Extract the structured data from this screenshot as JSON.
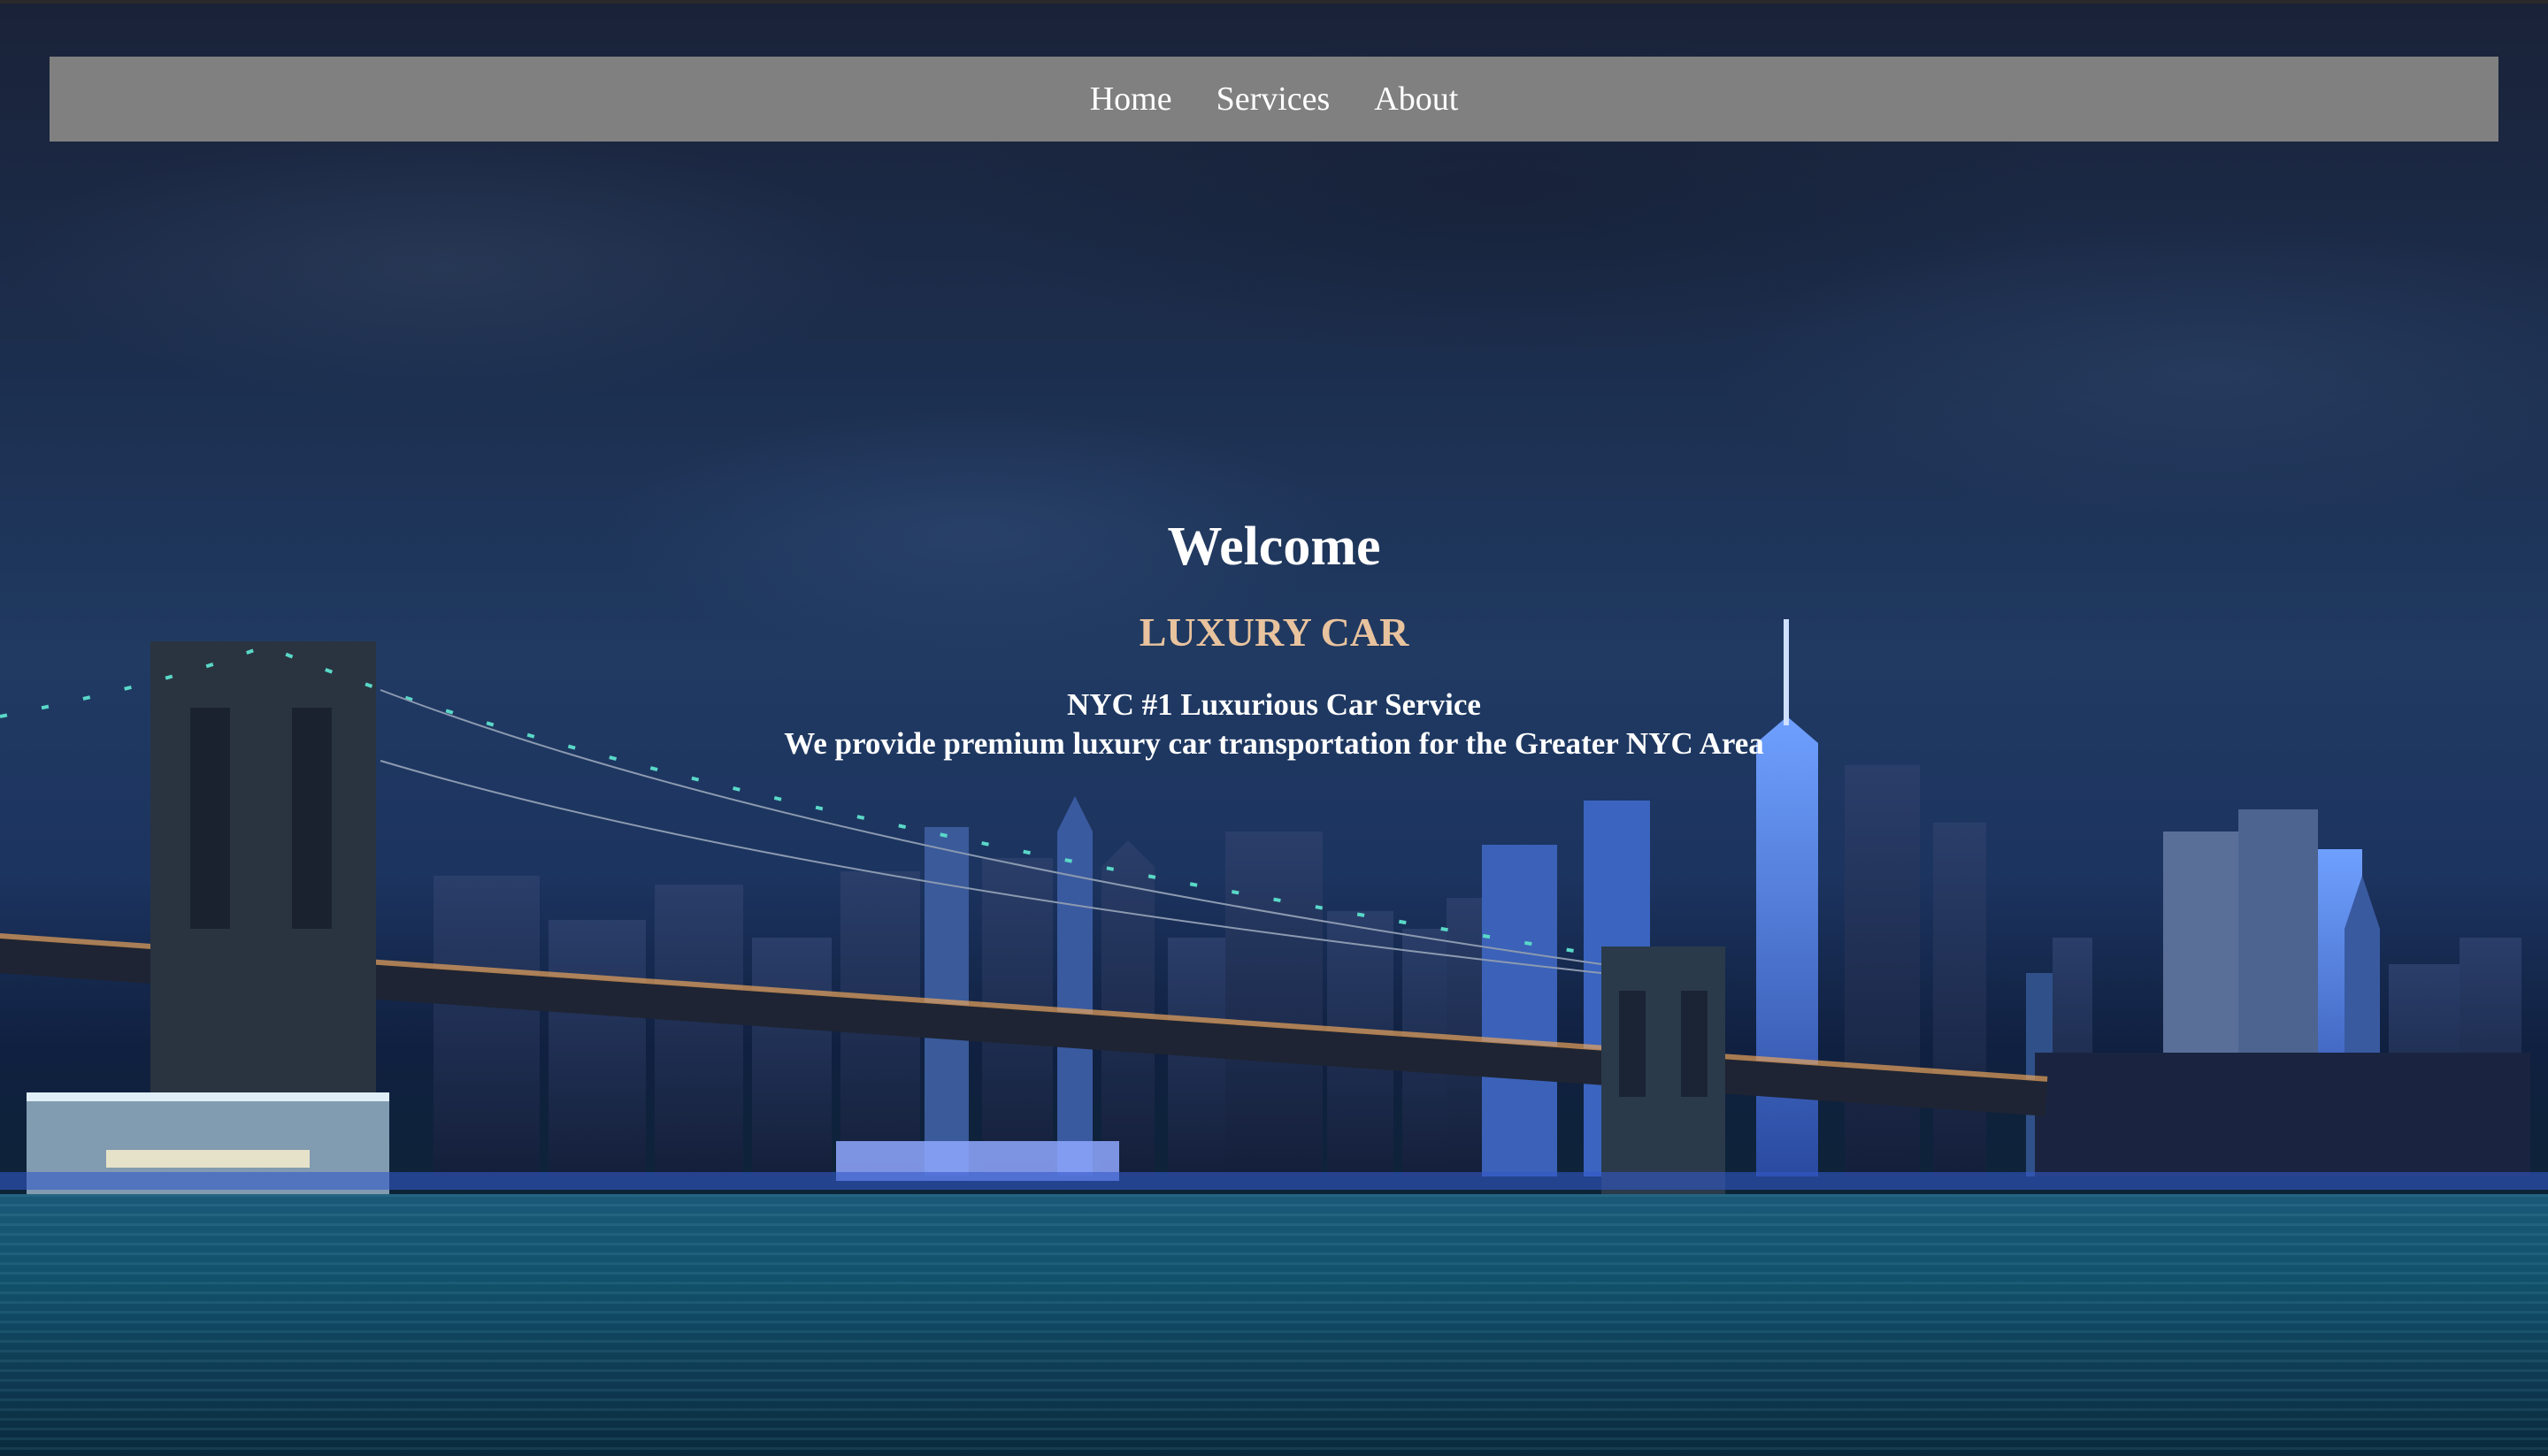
{
  "nav": {
    "items": [
      {
        "label": "Home"
      },
      {
        "label": "Services"
      },
      {
        "label": "About"
      }
    ]
  },
  "hero": {
    "title": "Welcome",
    "brand": "LUXURY CAR",
    "tagline": "NYC #1 Luxurious Car Service",
    "description": "We provide premium luxury car transportation for the Greater NYC Area"
  },
  "colors": {
    "navbar_bg": "#808080",
    "brand_accent": "#e8c39e",
    "text": "#ffffff"
  }
}
